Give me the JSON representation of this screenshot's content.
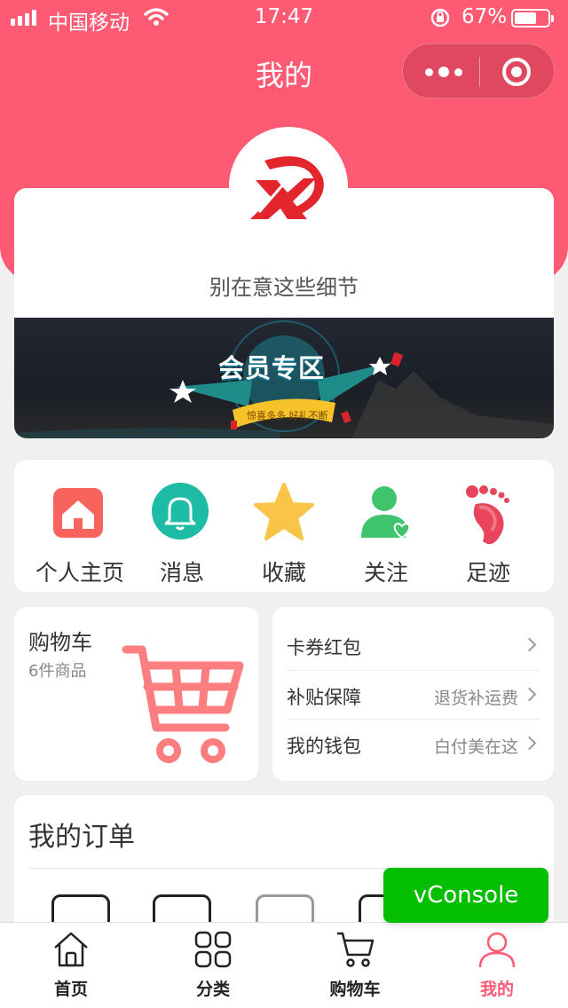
{
  "status_bar": {
    "carrier": "中国移动",
    "time": "17:47",
    "battery": "67%",
    "battery_level": 0.67
  },
  "nav": {
    "title": "我的"
  },
  "profile": {
    "username": "别在意这些细节",
    "banner_title": "会员专区",
    "banner_subtitle": "惊喜多多  好礼不断"
  },
  "quick_actions": [
    {
      "label": "个人主页",
      "icon": "home-icon",
      "color": "#f8645d"
    },
    {
      "label": "消息",
      "icon": "bell-icon",
      "color": "#1ebba6"
    },
    {
      "label": "收藏",
      "icon": "star-icon",
      "color": "#f9c447"
    },
    {
      "label": "关注",
      "icon": "user-follow-icon",
      "color": "#3fc36b"
    },
    {
      "label": "足迹",
      "icon": "footprint-icon",
      "color": "#e8445b"
    }
  ],
  "cart": {
    "title": "购物车",
    "count": "6件商品",
    "icon": "shopping-cart-icon",
    "color": "#fc7e7f"
  },
  "wallet": [
    {
      "label": "卡券红包",
      "value": ""
    },
    {
      "label": "补贴保障",
      "value": "退货补运费"
    },
    {
      "label": "我的钱包",
      "value": "白付美在这"
    }
  ],
  "orders": {
    "title": "我的订单"
  },
  "vconsole": {
    "label": "vConsole"
  },
  "tabbar": [
    {
      "label": "首页",
      "icon": "home-outline-icon",
      "active": false
    },
    {
      "label": "分类",
      "icon": "grid-icon",
      "active": false
    },
    {
      "label": "购物车",
      "icon": "cart-outline-icon",
      "active": false
    },
    {
      "label": "我的",
      "icon": "person-icon",
      "active": true
    }
  ],
  "colors": {
    "brand": "#fe5a73",
    "background": "#f0f0f0",
    "vconsole": "#04be02"
  }
}
